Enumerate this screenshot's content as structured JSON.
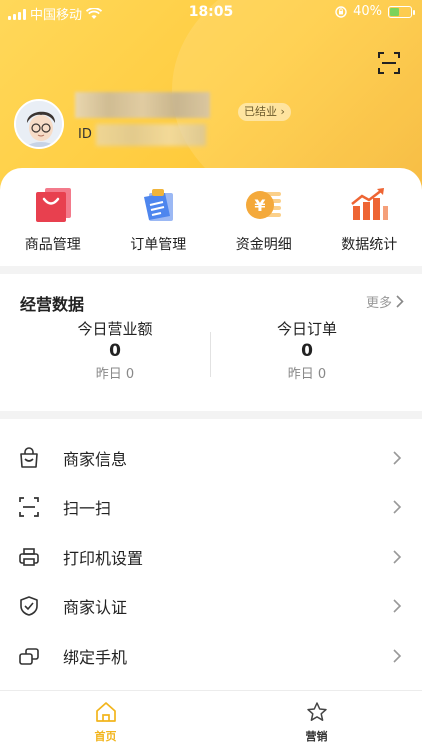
{
  "status_bar": {
    "carrier": "中国移动",
    "time": "18:05",
    "battery": "40%"
  },
  "profile": {
    "id_label": "ID",
    "status_badge": "已结业 ›"
  },
  "quick_actions": [
    {
      "label": "商品管理",
      "icon": "shopping-bag-icon"
    },
    {
      "label": "订单管理",
      "icon": "clipboard-icon"
    },
    {
      "label": "资金明细",
      "icon": "yuan-coin-icon"
    },
    {
      "label": "数据统计",
      "icon": "bar-chart-icon"
    }
  ],
  "operations": {
    "title": "经营数据",
    "more": "更多",
    "stats": [
      {
        "title": "今日营业额",
        "value": "0",
        "yesterday": "昨日 0"
      },
      {
        "title": "今日订单",
        "value": "0",
        "yesterday": "昨日 0"
      }
    ]
  },
  "menu": [
    {
      "label": "商家信息",
      "icon": "store-icon"
    },
    {
      "label": "扫一扫",
      "icon": "scan-icon"
    },
    {
      "label": "打印机设置",
      "icon": "printer-icon"
    },
    {
      "label": "商家认证",
      "icon": "shield-check-icon"
    },
    {
      "label": "绑定手机",
      "icon": "phone-link-icon"
    }
  ],
  "tabbar": [
    {
      "label": "首页",
      "icon": "home-icon",
      "color": "#f2b51d"
    },
    {
      "label": "营销",
      "icon": "star-icon",
      "color": "#333333"
    }
  ]
}
